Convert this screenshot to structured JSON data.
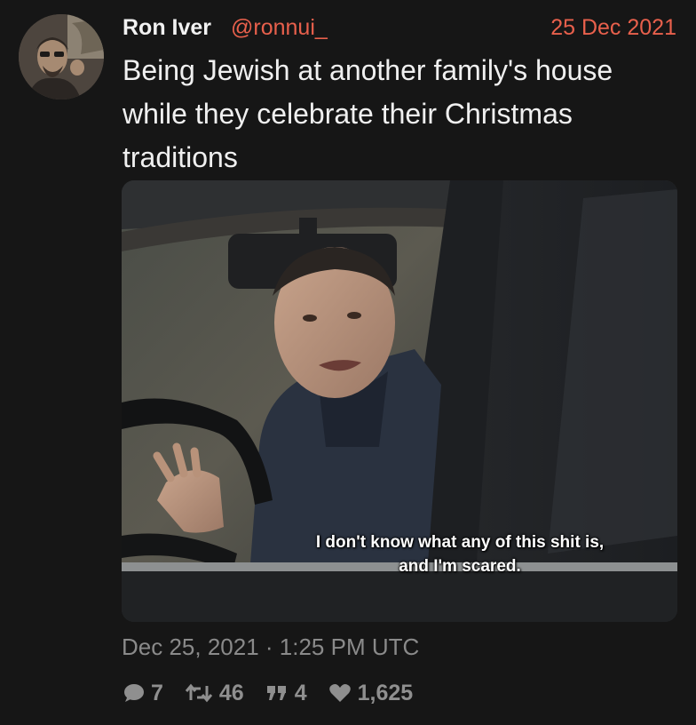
{
  "tweet": {
    "author_name": "Ron Iver",
    "handle": "@ronnui_",
    "date_short": "25 Dec 2021",
    "text": "Being Jewish at another family's house\nwhile they celebrate their Christmas\ntraditions",
    "media": {
      "subtitle": "I don't know what any of this shit is,\nand I'm scared."
    },
    "timestamp": "Dec 25, 2021 · 1:25 PM UTC",
    "stats": {
      "replies": "7",
      "retweets": "46",
      "quotes": "4",
      "likes": "1,625"
    }
  },
  "icons": {
    "reply": "comment-bubble-icon",
    "retweet": "retweet-icon",
    "quote": "quote-icon",
    "like": "heart-icon"
  },
  "colors": {
    "background": "#161616",
    "accent": "#e8604c",
    "muted": "#8a8a8a"
  }
}
